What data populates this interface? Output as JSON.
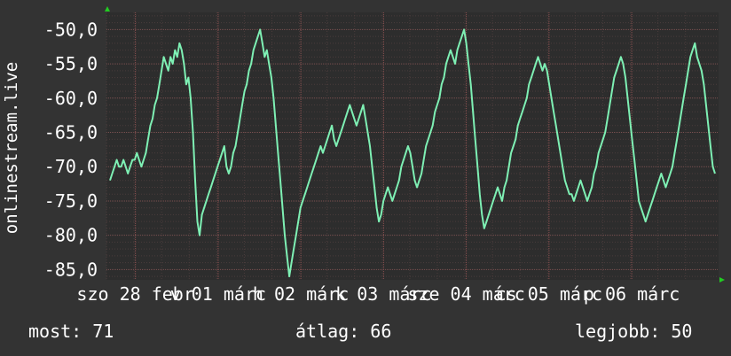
{
  "chart_data": {
    "type": "line",
    "ylabel": "onlinestream.live",
    "ylim": [
      -86.5,
      -47.5
    ],
    "y_ticks": [
      "-50,0",
      "-55,0",
      "-60,0",
      "-65,0",
      "-70,0",
      "-75,0",
      "-80,0",
      "-85,0"
    ],
    "y_tick_values": [
      -50,
      -55,
      -60,
      -65,
      -70,
      -75,
      -80,
      -85
    ],
    "x_tick_labels": [
      "szo 28 febr",
      "v 01 márc",
      "h 02 márc",
      "k 03 márc",
      "sze 04 márc",
      "cs 05 márc",
      "p 06 márc"
    ],
    "grid": true,
    "colors": {
      "background": "#333333",
      "plot": "#2d2d2d",
      "grid": "#6a4848",
      "line": "#7ef0b4",
      "axis_arrow": "#22cc22",
      "text": "#ffffff"
    },
    "series": [
      {
        "values": [
          -72,
          -71,
          -70,
          -69,
          -70,
          -70,
          -69,
          -70,
          -71,
          -70,
          -69,
          -69,
          -68,
          -69,
          -70,
          -69,
          -68,
          -66,
          -64,
          -63,
          -61,
          -60,
          -58,
          -56,
          -54,
          -55,
          -56,
          -54,
          -55,
          -53,
          -54,
          -52,
          -53,
          -55,
          -58,
          -57,
          -60,
          -65,
          -72,
          -78,
          -80,
          -77,
          -76,
          -75,
          -74,
          -73,
          -72,
          -71,
          -70,
          -69,
          -68,
          -67,
          -70,
          -71,
          -70,
          -68,
          -67,
          -65,
          -63,
          -61,
          -59,
          -58,
          -56,
          -55,
          -53,
          -52,
          -51,
          -50,
          -52,
          -54,
          -53,
          -55,
          -57,
          -60,
          -64,
          -68,
          -72,
          -76,
          -80,
          -83,
          -86,
          -84,
          -82,
          -80,
          -78,
          -76,
          -75,
          -74,
          -73,
          -72,
          -71,
          -70,
          -69,
          -68,
          -67,
          -68,
          -67,
          -66,
          -65,
          -64,
          -66,
          -67,
          -66,
          -65,
          -64,
          -63,
          -62,
          -61,
          -62,
          -63,
          -64,
          -63,
          -62,
          -61,
          -63,
          -65,
          -67,
          -70,
          -73,
          -76,
          -78,
          -77,
          -75,
          -74,
          -73,
          -74,
          -75,
          -74,
          -73,
          -72,
          -70,
          -69,
          -68,
          -67,
          -68,
          -70,
          -72,
          -73,
          -72,
          -71,
          -69,
          -67,
          -66,
          -65,
          -64,
          -62,
          -61,
          -60,
          -58,
          -57,
          -55,
          -54,
          -53,
          -54,
          -55,
          -53,
          -52,
          -51,
          -50,
          -52,
          -55,
          -58,
          -62,
          -66,
          -70,
          -74,
          -77,
          -79,
          -78,
          -77,
          -76,
          -75,
          -74,
          -73,
          -74,
          -75,
          -73,
          -72,
          -70,
          -68,
          -67,
          -66,
          -64,
          -63,
          -62,
          -61,
          -60,
          -58,
          -57,
          -56,
          -55,
          -54,
          -55,
          -56,
          -55,
          -56,
          -58,
          -60,
          -62,
          -64,
          -66,
          -68,
          -70,
          -72,
          -73,
          -74,
          -74,
          -75,
          -74,
          -73,
          -72,
          -73,
          -74,
          -75,
          -74,
          -73,
          -71,
          -70,
          -68,
          -67,
          -66,
          -65,
          -63,
          -61,
          -59,
          -57,
          -56,
          -55,
          -54,
          -55,
          -57,
          -60,
          -63,
          -66,
          -69,
          -72,
          -75,
          -76,
          -77,
          -78,
          -77,
          -76,
          -75,
          -74,
          -73,
          -72,
          -71,
          -72,
          -73,
          -72,
          -71,
          -70,
          -68,
          -66,
          -64,
          -62,
          -60,
          -58,
          -56,
          -54,
          -53,
          -52,
          -54,
          -55,
          -56,
          -58,
          -61,
          -64,
          -67,
          -70,
          -71
        ]
      }
    ],
    "stats": [
      {
        "label": "most:",
        "value": "71"
      },
      {
        "label": "átlag:",
        "value": "66"
      },
      {
        "label": "legjobb:",
        "value": "50"
      }
    ]
  }
}
